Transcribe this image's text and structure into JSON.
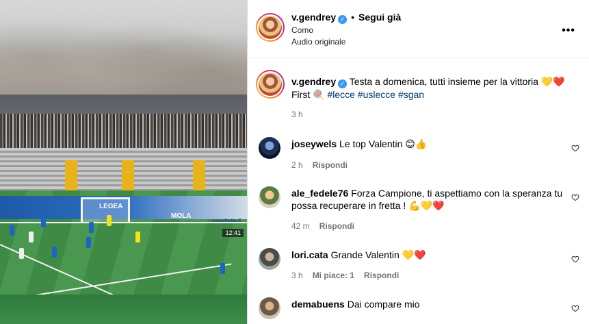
{
  "post": {
    "username": "v.gendrey",
    "verified_mark": "✓",
    "separator": "•",
    "follow_label": "Segui già",
    "location": "Como",
    "audio": "Audio originale",
    "more_icon": "more-options-icon",
    "more_glyph": "•••"
  },
  "media": {
    "boards_left": "LEGEA",
    "boards_mid": "MOLA",
    "boards_right": "randstad",
    "scorebug": "12:41"
  },
  "caption": {
    "username": "v.gendrey",
    "text_before_tags": "Testa a domenica, tutti insieme per la vittoria 💛❤️ First 🍭",
    "tags": [
      "#lecce",
      "#uslecce",
      "#sgan"
    ],
    "time": "3 h"
  },
  "comments": [
    {
      "username": "joseywels",
      "text": "Le top Valentin 😊👍",
      "time": "2 h",
      "likes": "",
      "reply": "Rispondi"
    },
    {
      "username": "ale_fedele76",
      "text": "Forza Campione, ti aspettiamo con la speranza tu possa recuperare in fretta ! 💪💛❤️",
      "time": "42 m",
      "likes": "",
      "reply": "Rispondi"
    },
    {
      "username": "lori.cata",
      "text": "Grande Valentin 💛❤️",
      "time": "3 h",
      "likes": "Mi piace: 1",
      "reply": "Rispondi"
    },
    {
      "username": "demabuens",
      "text": "Dai compare mio",
      "time": "",
      "likes": "",
      "reply": ""
    }
  ],
  "colors": {
    "accent_link": "#00376b",
    "verified": "#3897f0",
    "meta_gray": "#737373"
  }
}
